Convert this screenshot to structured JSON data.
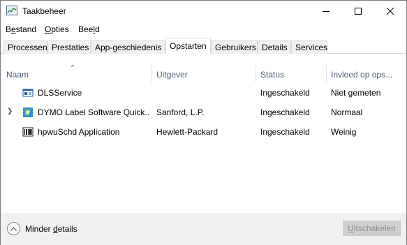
{
  "window": {
    "title": "Taakbeheer"
  },
  "menu": [
    {
      "pre": "B",
      "accel": "e",
      "post": "stand"
    },
    {
      "pre": "",
      "accel": "O",
      "post": "pties"
    },
    {
      "pre": "Bee",
      "accel": "l",
      "post": "d"
    }
  ],
  "tabs": [
    "Processen",
    "Prestaties",
    "App-geschiedenis",
    "Opstarten",
    "Gebruikers",
    "Details",
    "Services"
  ],
  "active_tab": "Opstarten",
  "columns": {
    "name": "Naam",
    "publisher": "Uitgever",
    "status": "Status",
    "impact": "Invloed op ops..."
  },
  "rows": [
    {
      "name": "DLSService",
      "publisher": "",
      "status": "Ingeschakeld",
      "impact": "Niet gemeten",
      "expandable": false,
      "icon": "dls-service-icon"
    },
    {
      "name": "DYMO Label Software Quick...",
      "publisher": "Sanford, L.P.",
      "status": "Ingeschakeld",
      "impact": "Normaal",
      "expandable": true,
      "icon": "dymo-label-icon"
    },
    {
      "name": "hpwuSchd Application",
      "publisher": "Hewlett-Packard",
      "status": "Ingeschakeld",
      "impact": "Weinig",
      "expandable": false,
      "icon": "hp-barcode-icon"
    }
  ],
  "footer": {
    "details_pre": "Minder ",
    "details_accel": "d",
    "details_post": "etails",
    "disable_accel": "U",
    "disable_post": "itschakelen"
  }
}
